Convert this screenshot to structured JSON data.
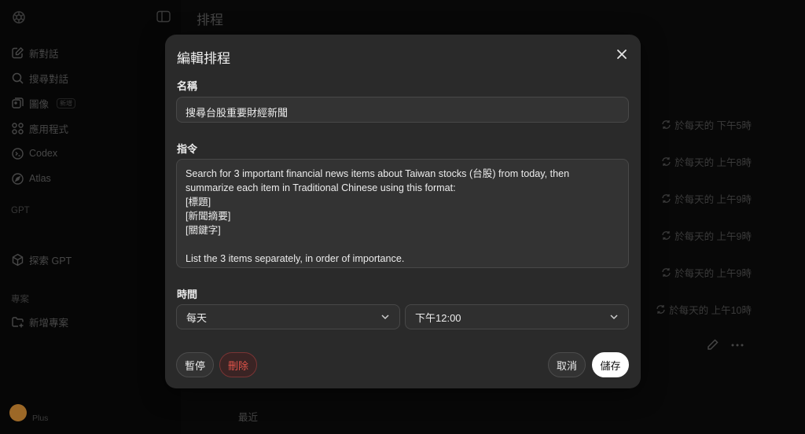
{
  "sidebar": {
    "items": [
      {
        "label": "新對話",
        "icon": "new-chat-icon"
      },
      {
        "label": "搜尋對話",
        "icon": "search-icon"
      },
      {
        "label": "圖像",
        "icon": "images-icon",
        "badge": "新增"
      },
      {
        "label": "應用程式",
        "icon": "apps-icon"
      },
      {
        "label": "Codex",
        "icon": "codex-icon"
      },
      {
        "label": "Atlas",
        "icon": "atlas-icon"
      }
    ],
    "gpt_section": "GPT",
    "explore_gpt": "探索 GPT",
    "projects_section": "專案",
    "new_project": "新增專案",
    "plan": "Plus"
  },
  "page": {
    "title": "排程",
    "schedules": [
      "於每天的 下午5時",
      "於每天的 上午8時",
      "於每天的 上午9時",
      "於每天的 上午9時",
      "於每天的 上午9時",
      "於每天的 上午10時"
    ],
    "recent_label": "最近"
  },
  "modal": {
    "title": "編輯排程",
    "name_label": "名稱",
    "name_value": "搜尋台股重要財經新聞",
    "prompt_label": "指令",
    "prompt_value": "Search for 3 important financial news items about Taiwan stocks (台股) from today, then\nsummarize each item in Traditional Chinese using this format:\n[標題]\n[新聞摘要]\n[關鍵字]\n\nList the 3 items separately, in order of importance.",
    "time_label": "時間",
    "frequency_value": "每天",
    "time_value": "下午12:00",
    "pause_label": "暫停",
    "delete_label": "刪除",
    "cancel_label": "取消",
    "save_label": "儲存"
  },
  "colors": {
    "modal_bg": "#2a2a2a",
    "delete": "#e0534a",
    "save_bg": "#ffffff",
    "avatar": "#f0a03c"
  }
}
